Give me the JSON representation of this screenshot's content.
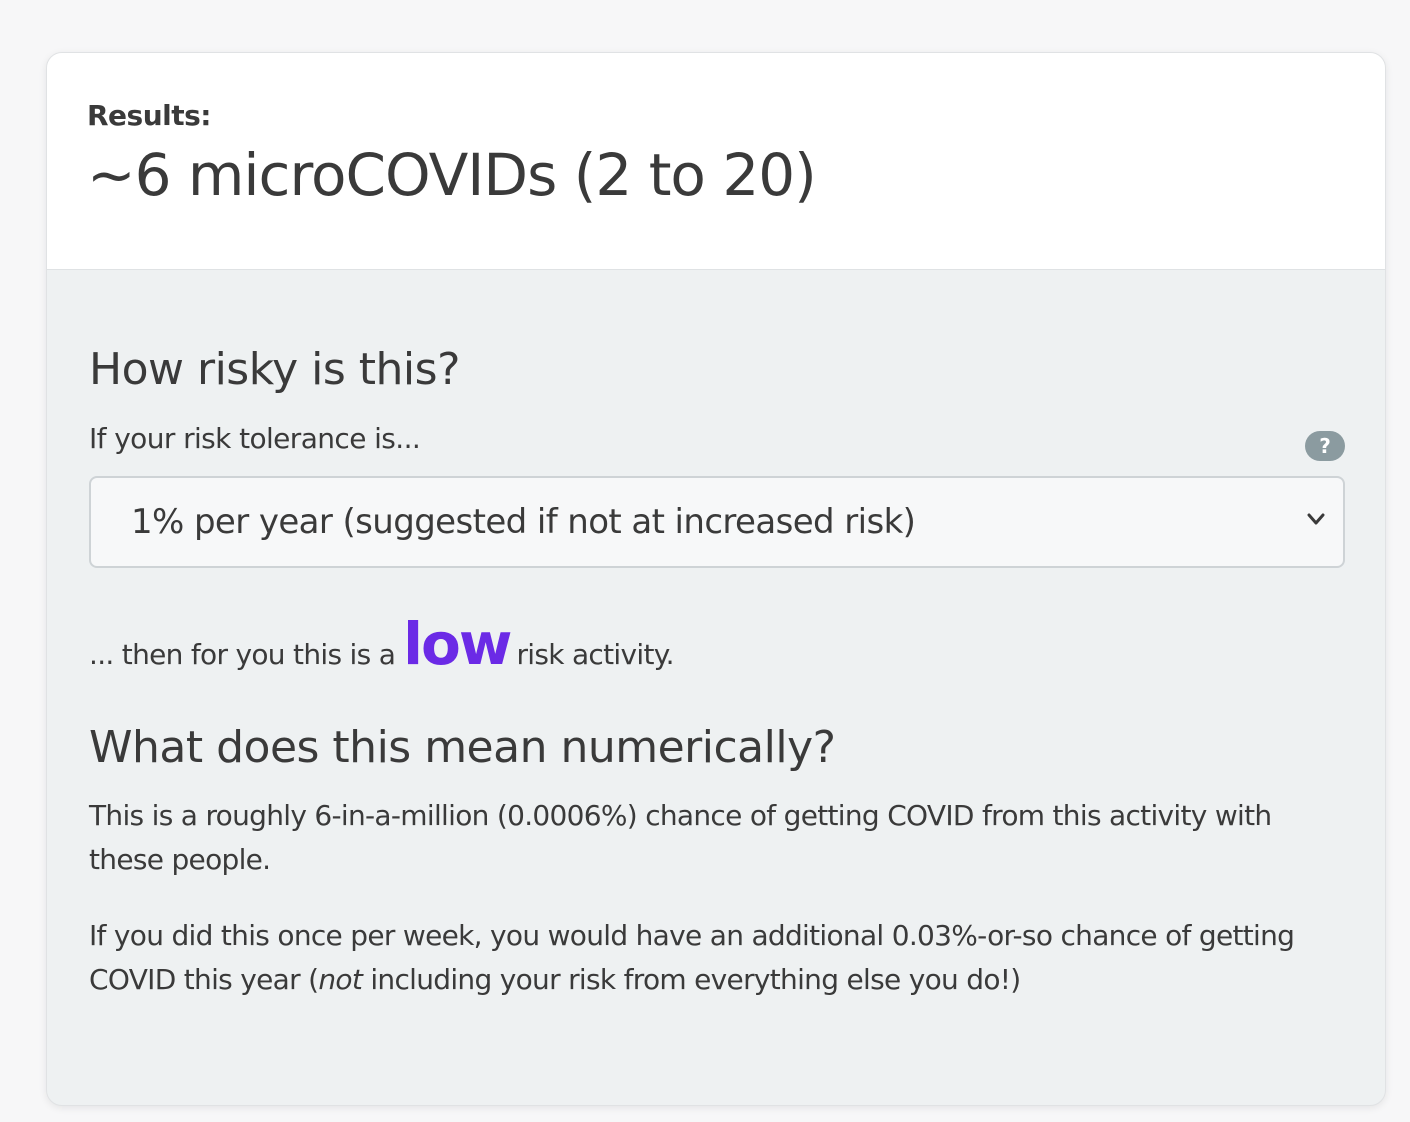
{
  "results": {
    "label": "Results:",
    "value": "~6 microCOVIDs (2 to 20)"
  },
  "risk_section": {
    "heading": "How risky is this?",
    "tolerance_label": "If your risk tolerance is...",
    "help_icon": "question-icon",
    "help_glyph": "?",
    "selected_option": "1% per year (suggested if not at increased risk)",
    "then_prefix": "... then for you this is a",
    "risk_level": "low",
    "then_suffix": "risk activity.",
    "level_color": "#6b2ae6"
  },
  "numeric_section": {
    "heading": "What does this mean numerically?",
    "paragraph1": "This is a roughly 6-in-a-million (0.0006%) chance of getting COVID from this activity with these people.",
    "paragraph2_before": "If you did this once per week, you would have an additional 0.03%-or-so chance of getting COVID this year (",
    "paragraph2_emph": "not",
    "paragraph2_after": " including your risk from everything else you do!)"
  }
}
